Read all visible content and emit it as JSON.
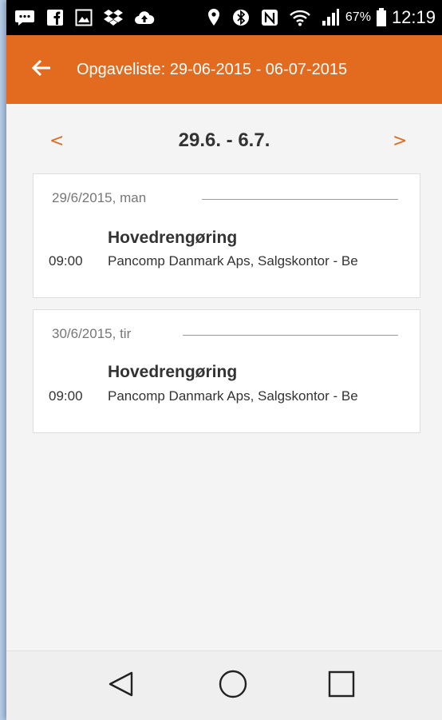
{
  "status_bar": {
    "battery_percent": "67%",
    "time": "12:19",
    "icons": [
      "message-icon",
      "facebook-icon",
      "gallery-icon",
      "dropbox-icon",
      "cloud-upload-icon",
      "location-icon",
      "bluetooth-icon",
      "nfc-icon",
      "wifi-icon",
      "signal-icon",
      "battery-icon"
    ]
  },
  "appbar": {
    "title": "Opgaveliste: 29-06-2015 - 06-07-2015",
    "back_icon": "arrow-left-icon"
  },
  "week_nav": {
    "prev": "<",
    "label": "29.6. - 6.7.",
    "next": ">"
  },
  "tasks": [
    {
      "date": "29/6/2015, man",
      "time": "09:00",
      "title": "Hovedrengøring",
      "description": "Pancomp Danmark Aps, Salgskontor - Be"
    },
    {
      "date": "30/6/2015, tir",
      "time": "09:00",
      "title": "Hovedrengøring",
      "description": "Pancomp Danmark Aps, Salgskontor - Be"
    }
  ],
  "colors": {
    "accent": "#e26b1f",
    "background": "#f4f4f4",
    "card": "#ffffff"
  },
  "nav_bar": [
    "back-triangle-icon",
    "home-circle-icon",
    "recents-square-icon"
  ]
}
